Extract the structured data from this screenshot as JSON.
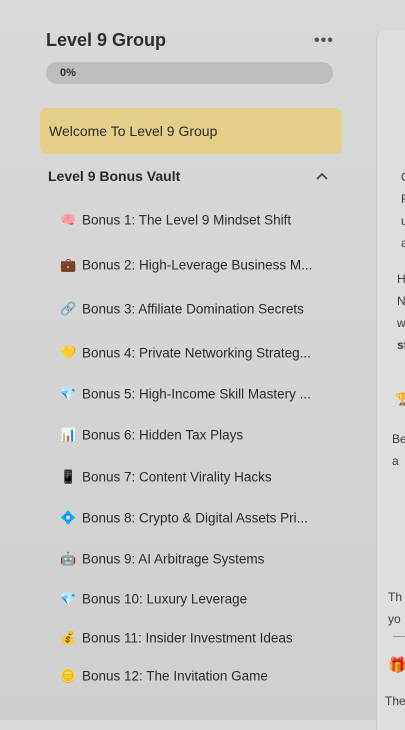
{
  "sidebar": {
    "title": "Level 9 Group",
    "more_icon": "more-horizontal-icon",
    "progress": {
      "label": "0%",
      "value": 0
    },
    "welcome_lesson": "Welcome To Level 9 Group",
    "section": {
      "title": "Level 9 Bonus Vault",
      "expanded": true,
      "lessons": [
        {
          "icon": "🧠",
          "icon_name": "brain-icon",
          "label": "Bonus 1: The Level 9 Mindset Shift"
        },
        {
          "icon": "💼",
          "icon_name": "briefcase-icon",
          "label": "Bonus 2: High-Leverage Business M..."
        },
        {
          "icon": "🔗",
          "icon_name": "link-icon",
          "label": "Bonus 3: Affiliate Domination Secrets"
        },
        {
          "icon": "💛",
          "icon_name": "heart-icon",
          "label": "Bonus 4: Private Networking Strateg..."
        },
        {
          "icon": "💎",
          "icon_name": "gem-icon",
          "label": "Bonus 5: High-Income Skill Mastery ..."
        },
        {
          "icon": "📊",
          "icon_name": "chart-icon",
          "label": "Bonus 6: Hidden Tax Plays"
        },
        {
          "icon": "📱",
          "icon_name": "phone-icon",
          "label": "Bonus 7: Content Virality Hacks"
        },
        {
          "icon": "💠",
          "icon_name": "diamond-icon",
          "label": "Bonus 8: Crypto & Digital Assets Pri..."
        },
        {
          "icon": "🤖",
          "icon_name": "robot-icon",
          "label": "Bonus 9: AI Arbitrage Systems"
        },
        {
          "icon": "💎",
          "icon_name": "gem-icon",
          "label": "Bonus 10: Luxury Leverage"
        },
        {
          "icon": "💰",
          "icon_name": "money-bag-icon",
          "label": "Bonus 11: Insider Investment Ideas"
        },
        {
          "icon": "🪙",
          "icon_name": "coin-icon",
          "label": "Bonus 12: The Invitation Game"
        }
      ]
    }
  },
  "main_peek": {
    "lines": [
      "C",
      "F",
      "u",
      "a",
      "H",
      "N",
      "w",
      "st",
      "🏆",
      "Be",
      "a",
      "Th",
      "yo",
      "🎁",
      "The"
    ]
  },
  "colors": {
    "accent": "#e3cf88",
    "progress_track": "#bdbdbd",
    "background": "#d6d6d6"
  }
}
